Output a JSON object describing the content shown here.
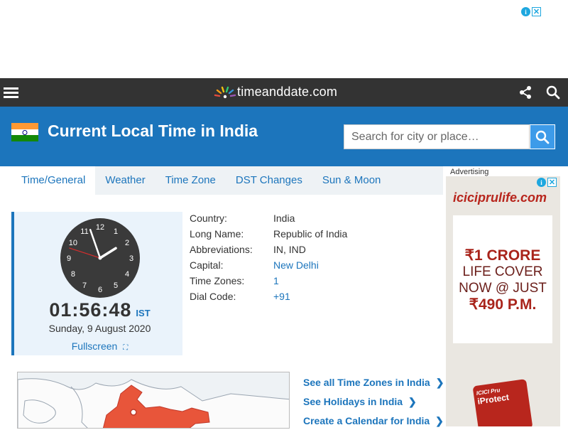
{
  "header": {
    "logo_text": "timeanddate.com"
  },
  "banner": {
    "title": "Current Local Time in India",
    "search_placeholder": "Search for city or place…"
  },
  "tabs": [
    {
      "label": "Time/General",
      "active": true
    },
    {
      "label": "Weather"
    },
    {
      "label": "Time Zone"
    },
    {
      "label": "DST Changes"
    },
    {
      "label": "Sun & Moon"
    }
  ],
  "clock": {
    "time": "01:56:48",
    "zone": "IST",
    "date": "Sunday, 9 August 2020",
    "fullscreen_label": "Fullscreen",
    "numerals": [
      "12",
      "1",
      "2",
      "3",
      "4",
      "5",
      "6",
      "7",
      "8",
      "9",
      "10",
      "11"
    ],
    "hours": 1,
    "minutes": 56,
    "seconds": 48
  },
  "info": [
    {
      "key": "Country:",
      "value": "India",
      "link": false
    },
    {
      "key": "Long Name:",
      "value": "Republic of India",
      "link": false
    },
    {
      "key": "Abbreviations:",
      "value": "IN, IND",
      "link": false
    },
    {
      "key": "Capital:",
      "value": "New Delhi",
      "link": true
    },
    {
      "key": "Time Zones:",
      "value": "1",
      "link": true
    },
    {
      "key": "Dial Code:",
      "value": "+91",
      "link": true
    }
  ],
  "links": [
    {
      "label": "See all Time Zones in India"
    },
    {
      "label": "See Holidays in India"
    },
    {
      "label": "Create a Calendar for India"
    }
  ],
  "ads": {
    "label": "Advertising",
    "brand": "iciciprulife.com",
    "offer_line1": "₹1 CRORE",
    "offer_line2": "LIFE COVER",
    "offer_line3": "NOW @ JUST",
    "offer_line4": "₹490 P.M.",
    "badge_line1": "ICICI Pru",
    "badge_line2": "iProtect"
  },
  "colors": {
    "topbar": "#333333",
    "brand_blue": "#1c75bc",
    "flag_saffron": "#ff9933",
    "flag_green": "#138808",
    "map_red": "#e8553a"
  }
}
